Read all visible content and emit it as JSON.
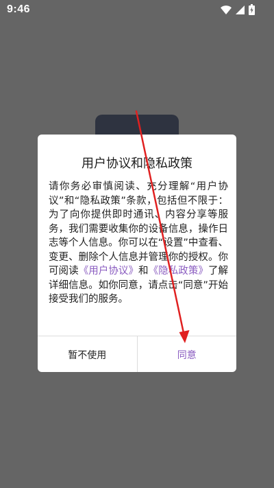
{
  "status_bar": {
    "time": "9:46",
    "icons": [
      "wifi-icon",
      "cellular-signal-icon",
      "battery-charging-icon"
    ]
  },
  "dialog": {
    "title": "用户协议和隐私政策",
    "body": {
      "intro": "请你务必审慎阅读、充分理解“用户协议”和“隐私政策”条款，包括但不限于：为了向你提供即时通讯、内容分享等服务，我们需要收集你的设备信息，操作日志等个人信息。你可以在“设置”中查看、变更、删除个人信息并管理你的授权。你可阅读",
      "user_agreement_link": "《用户协议》",
      "and": "和",
      "privacy_policy_link": "《隐私政策》",
      "outro": "了解详细信息。如你同意，请点击“同意”开始接受我们的服务。"
    },
    "buttons": {
      "decline": "暂不使用",
      "agree": "同意"
    }
  },
  "colors": {
    "overlay_background": "#656565",
    "accent": "#8a5cc0",
    "annotation_arrow": "#e02020"
  }
}
